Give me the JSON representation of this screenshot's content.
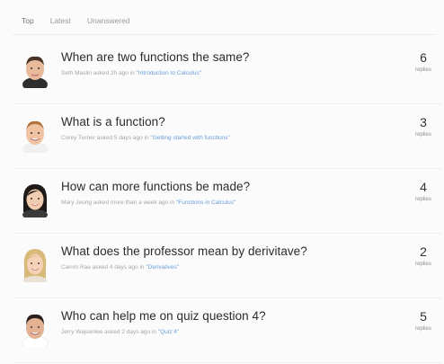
{
  "tabs": [
    {
      "label": "Top",
      "active": true
    },
    {
      "label": "Latest",
      "active": false
    },
    {
      "label": "Unanswered",
      "active": false
    }
  ],
  "questions": [
    {
      "title": "When are two functions the same?",
      "author": "Seth Maslin",
      "verb": "asked 2h ago in",
      "topic": "\"Introduction to Calculus\"",
      "replies": "6",
      "replies_label": "replies",
      "avatar": {
        "icon": "avatar-man-short-dark-hair-icon",
        "skin": "#e8b99a",
        "hair": "#4a3426"
      }
    },
    {
      "title": "What is a function?",
      "author": "Corey Turner",
      "verb": "asked 5 days ago in",
      "topic": "\"Getting started with functions\"",
      "replies": "3",
      "replies_label": "replies",
      "avatar": {
        "icon": "avatar-man-ginger-hair-icon",
        "skin": "#efc3a2",
        "hair": "#b5703a"
      }
    },
    {
      "title": "How can more functions be made?",
      "author": "Mary Jeong",
      "verb": "asked more than a week ago in",
      "topic": "\"Functions in Calculus\"",
      "replies": "4",
      "replies_label": "replies",
      "avatar": {
        "icon": "avatar-woman-dark-hair-icon",
        "skin": "#f0cdb0",
        "hair": "#1f1a18"
      }
    },
    {
      "title": "What does the professor mean by derivitave?",
      "author": "Camm Rae",
      "verb": "asked 4 days ago in",
      "topic": "\"Derivatives\"",
      "replies": "2",
      "replies_label": "replies",
      "avatar": {
        "icon": "avatar-woman-blonde-hair-icon",
        "skin": "#f3d2b8",
        "hair": "#d9b97a"
      }
    },
    {
      "title": "Who can help me on quiz question 4?",
      "author": "Jerry Wajsenlee",
      "verb": "asked 2 days ago in",
      "topic": "\"Quiz 4\"",
      "replies": "5",
      "replies_label": "replies",
      "avatar": {
        "icon": "avatar-man-dark-hair-icon",
        "skin": "#e2b293",
        "hair": "#2a1f1a"
      }
    }
  ]
}
